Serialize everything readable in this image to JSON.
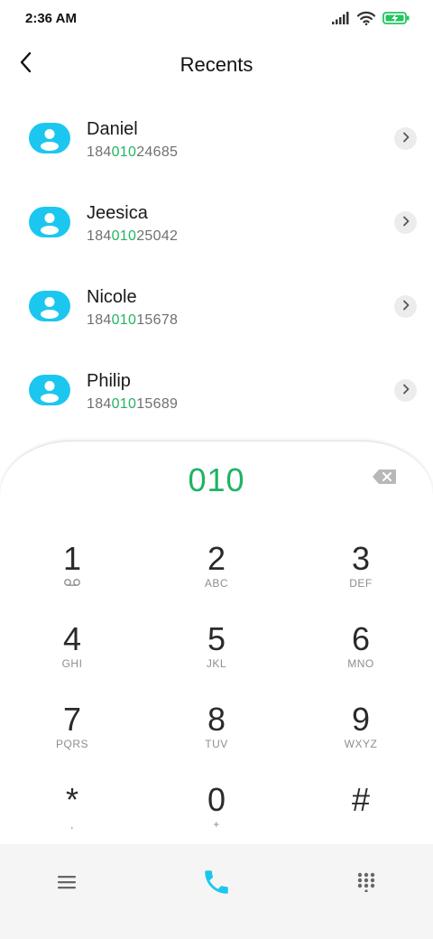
{
  "status_bar": {
    "time": "2:36 AM",
    "icons": [
      "signal-icon",
      "wifi-icon",
      "battery-charging-icon"
    ],
    "battery_color": "#22c55e"
  },
  "header": {
    "title": "Recents",
    "back_icon": "chevron-left-icon"
  },
  "contacts": [
    {
      "name": "Daniel",
      "number_prefix": "184",
      "number_match": "010",
      "number_suffix": "24685"
    },
    {
      "name": "Jeesica",
      "number_prefix": "184",
      "number_match": "010",
      "number_suffix": "25042"
    },
    {
      "name": "Nicole",
      "number_prefix": "184",
      "number_match": "010",
      "number_suffix": "15678"
    },
    {
      "name": "Philip",
      "number_prefix": "184",
      "number_match": "010",
      "number_suffix": "15689"
    }
  ],
  "dialpad": {
    "dialed": "010",
    "keys": [
      {
        "digit": "1",
        "letters": ""
      },
      {
        "digit": "2",
        "letters": "ABC"
      },
      {
        "digit": "3",
        "letters": "DEF"
      },
      {
        "digit": "4",
        "letters": "GHI"
      },
      {
        "digit": "5",
        "letters": "JKL"
      },
      {
        "digit": "6",
        "letters": "MNO"
      },
      {
        "digit": "7",
        "letters": "PQRS"
      },
      {
        "digit": "8",
        "letters": "TUV"
      },
      {
        "digit": "9",
        "letters": "WXYZ"
      },
      {
        "digit": "*",
        "letters": ","
      },
      {
        "digit": "0",
        "letters": "+"
      },
      {
        "digit": "#",
        "letters": ""
      }
    ]
  },
  "colors": {
    "accent": "#1cc7ef",
    "match_highlight": "#22b464",
    "call_button": "#1cc7ef"
  },
  "bottom_bar": {
    "icons": [
      "menu-icon",
      "phone-icon",
      "dialpad-grid-icon"
    ]
  }
}
